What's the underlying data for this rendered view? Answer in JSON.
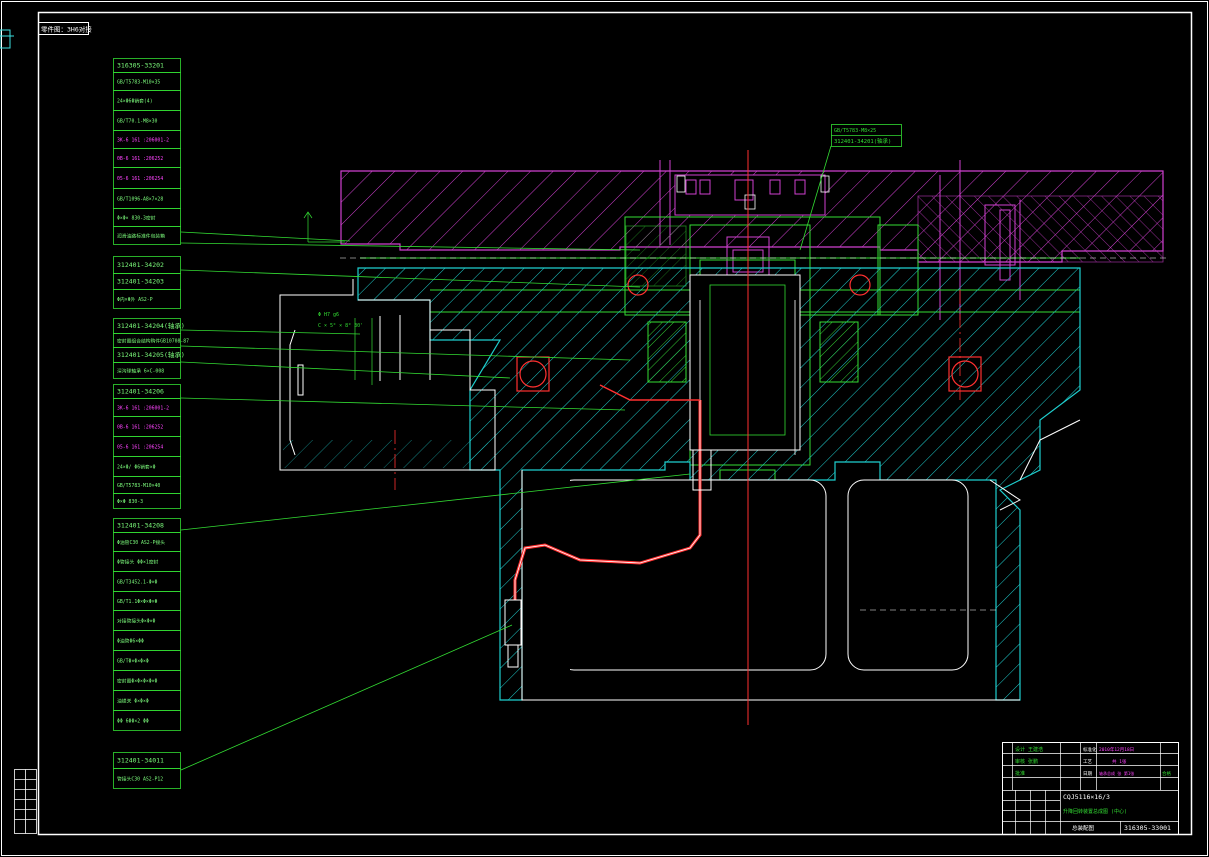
{
  "sheet_tag": "零件图：3H6对接",
  "callouts": [
    {
      "text": "316305-33201",
      "color": "#7CFC7C",
      "big": true
    },
    {
      "text": "GB/T5783-M10×35",
      "color": "#7CFC7C"
    },
    {
      "text": "24×Φ6Φ销套(4)",
      "color": "#7CFC7C"
    },
    {
      "text": "GB/T70.1-M8×30",
      "color": "#7CFC7C"
    },
    {
      "text": "3K-6 161 :206001-2",
      "color": "#FF44FF"
    },
    {
      "text": "0B-6 161 :206252",
      "color": "#FF44FF"
    },
    {
      "text": "05-6 161 :206254",
      "color": "#FF44FF"
    },
    {
      "text": "GB/T1096-A8×7×28",
      "color": "#7CFC7C"
    },
    {
      "text": "Φ×Φ× 830-3密封",
      "color": "#7CFC7C"
    },
    {
      "text": "润滑油路标准件包装箱",
      "color": "#7CFC7C"
    },
    {
      "text": "312401-34202",
      "color": "#7CFC7C",
      "big": true
    },
    {
      "text": "312401-34203",
      "color": "#7CFC7C",
      "big": true
    },
    {
      "text": "Φ内×Φ外 AS2-P",
      "color": "#7CFC7C"
    },
    {
      "text": "312401-34204(轴承)",
      "color": "#7CFC7C",
      "big": true
    },
    {
      "text": "密封圈组合结构购件GB10708-87",
      "color": "#7CFC7C"
    },
    {
      "text": "312401-34205(轴承)",
      "color": "#7CFC7C",
      "big": true
    },
    {
      "text": "深沟球轴承 6×C-008",
      "color": "#7CFC7C"
    },
    {
      "text": "312401-34206",
      "color": "#7CFC7C",
      "big": true
    },
    {
      "text": "3K-6 161 :206001-2",
      "color": "#FF44FF"
    },
    {
      "text": "0B-6 161 :206252",
      "color": "#FF44FF"
    },
    {
      "text": "05-6 161 :206254",
      "color": "#FF44FF"
    },
    {
      "text": "24×Φ/ Φ6销套×Φ",
      "color": "#7CFC7C"
    },
    {
      "text": "GB/T5783-M10×40",
      "color": "#7CFC7C"
    },
    {
      "text": "Φ×Φ 830-3",
      "color": "#7CFC7C"
    },
    {
      "text": "312401-34208",
      "color": "#7CFC7C",
      "big": true
    },
    {
      "text": "Φ油管C30 AS2-P接头",
      "color": "#7CFC7C"
    },
    {
      "text": "Φ管接头 ΦΦ×1密封",
      "color": "#7CFC7C"
    },
    {
      "text": "GB/T3452.1-Φ×Φ",
      "color": "#7CFC7C"
    },
    {
      "text": "GB/T1.1Φ×Φ×Φ×Φ",
      "color": "#7CFC7C"
    },
    {
      "text": "对接管接头Φ×Φ×Φ",
      "color": "#7CFC7C"
    },
    {
      "text": "Φ油管Φ6×ΦΦ",
      "color": "#7CFC7C"
    },
    {
      "text": "GB/TΦ×Φ×Φ×Φ",
      "color": "#7CFC7C"
    },
    {
      "text": "密封圈Φ×Φ×Φ×Φ×Φ",
      "color": "#7CFC7C"
    },
    {
      "text": "油锁关 Φ×Φ×Φ",
      "color": "#7CFC7C"
    },
    {
      "text": "ΦΦ 6ΦΦ×2 ΦΦ",
      "color": "#7CFC7C"
    },
    {
      "text": "312401-34011",
      "color": "#7CFC7C",
      "big": true
    },
    {
      "text": "管接头C30 AS2-P12",
      "color": "#7CFC7C"
    }
  ],
  "view_labels": {
    "top_callout": "GB/T5783-M8×25",
    "top_callout_2": "312401-34201(轴承)",
    "dim_1": "Φ H7 g6",
    "dim_2": "C × 5° × 8° 30'"
  },
  "title_block": {
    "r1c2": "设计 王建浩",
    "r1c4": "标准化",
    "r1c6": "2010年12月18日",
    "r2c2": "审核 张鹏",
    "r2c4": "工艺",
    "r2c6": "共 1张",
    "r3c2": "批准",
    "r3c4": "日期",
    "r3c6": "轴承总成 张 第1张",
    "r3c7": "合格",
    "name": "CQJ5116×16/3",
    "subtitle": "升降回转装置总成图 (中心)",
    "drawing_no": "316305-33001",
    "sheet_name": "总装配图"
  }
}
